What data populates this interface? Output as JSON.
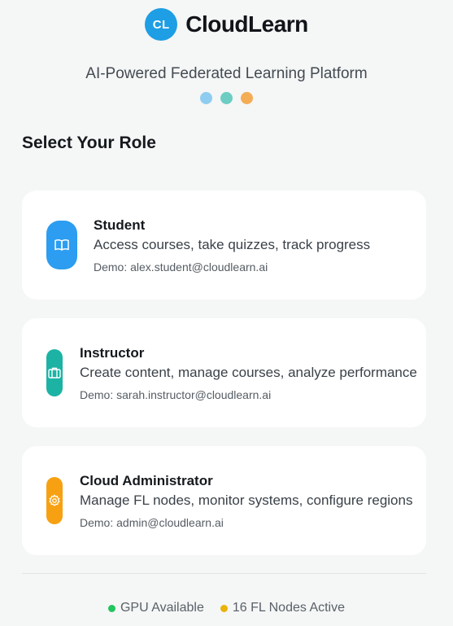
{
  "brand": {
    "logo_text": "CL",
    "name": "CloudLearn",
    "tagline": "AI-Powered Federated Learning Platform"
  },
  "colors": {
    "logo": "#1e9ee4",
    "dot1": "#8fcdf0",
    "dot2": "#6dcdc3",
    "dot3": "#f4ad55",
    "student": "#2c9df0",
    "instructor": "#1cb3a4",
    "admin": "#f7a112",
    "gpu_status": "#22c55e",
    "nodes_status": "#eab308"
  },
  "section_title": "Select Your Role",
  "roles": [
    {
      "title": "Student",
      "description": "Access courses, take quizzes, track progress",
      "demo": "Demo: alex.student@cloudlearn.ai",
      "icon": "book-open-icon"
    },
    {
      "title": "Instructor",
      "description": "Create content, manage courses, analyze performance",
      "demo": "Demo: sarah.instructor@cloudlearn.ai",
      "icon": "briefcase-icon"
    },
    {
      "title": "Cloud Administrator",
      "description": "Manage FL nodes, monitor systems, configure regions",
      "demo": "Demo: admin@cloudlearn.ai",
      "icon": "gear-icon"
    }
  ],
  "status": {
    "gpu": "GPU Available",
    "nodes": "16 FL Nodes Active"
  }
}
